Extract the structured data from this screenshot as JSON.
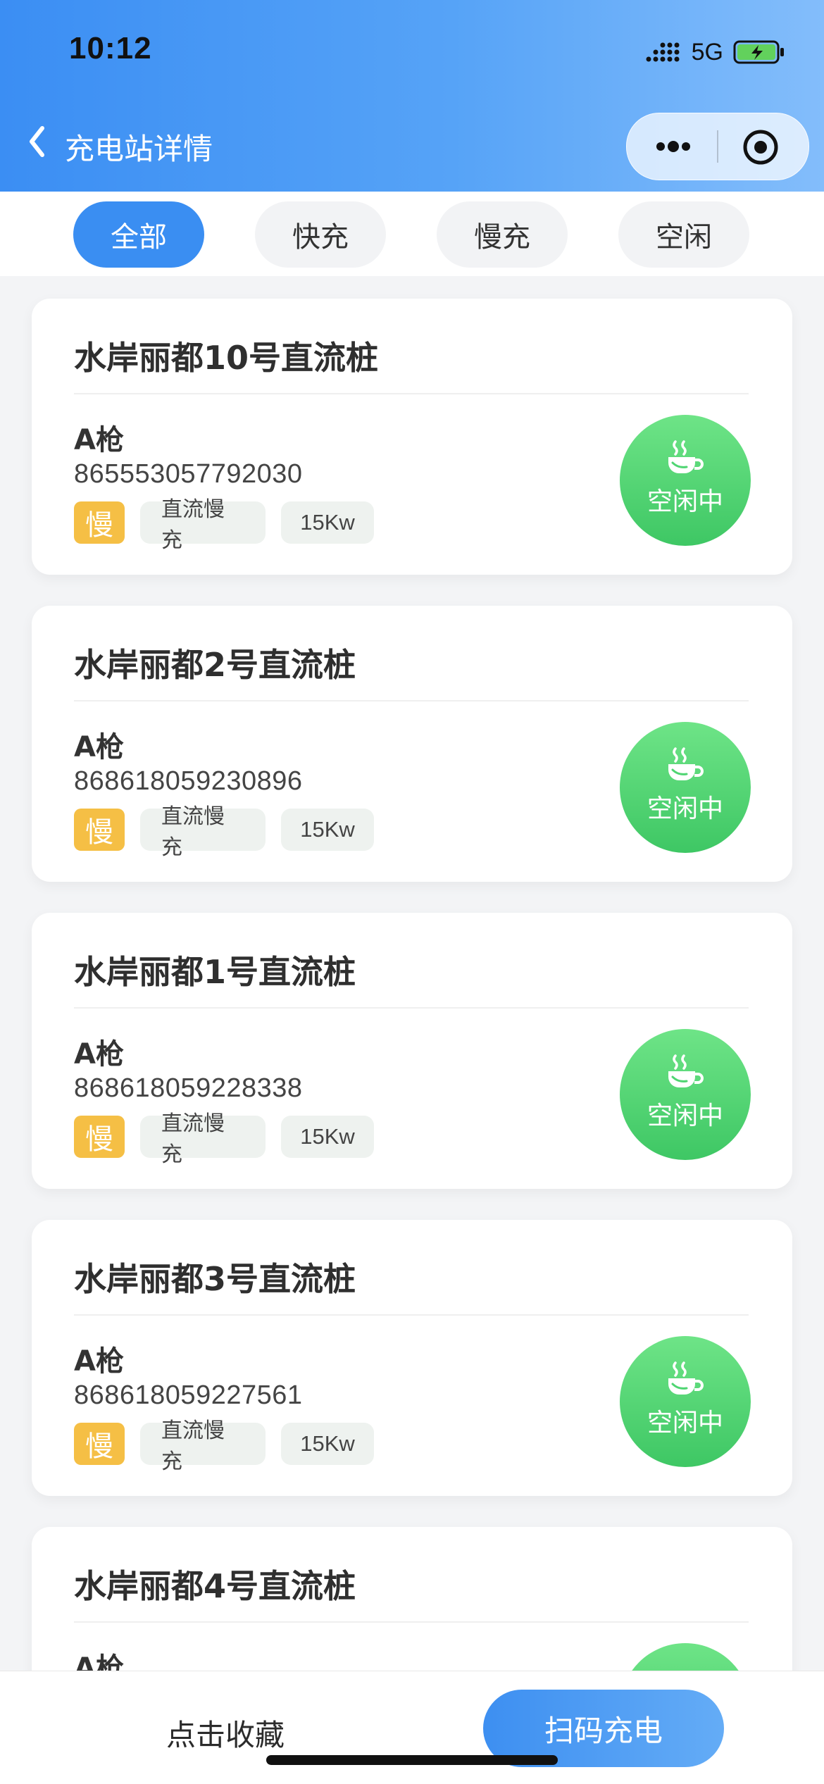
{
  "status_bar": {
    "time": "10:12",
    "network": "5G",
    "icons": [
      "signal-icon",
      "battery-charging-icon"
    ]
  },
  "nav": {
    "title": "充电站详情",
    "back_icon": "chevron-left-icon",
    "more_icon": "more-dots-icon",
    "close_icon": "target-close-icon"
  },
  "filters": [
    {
      "label": "全部",
      "active": true
    },
    {
      "label": "快充",
      "active": false
    },
    {
      "label": "慢充",
      "active": false
    },
    {
      "label": "空闲",
      "active": false
    }
  ],
  "piles": [
    {
      "title": "水岸丽都10号直流桩",
      "gun": "A枪",
      "serial": "865553057792030",
      "badge": "慢",
      "type": "直流慢充",
      "power": "15Kw",
      "status": "空闲中"
    },
    {
      "title": "水岸丽都2号直流桩",
      "gun": "A枪",
      "serial": "868618059230896",
      "badge": "慢",
      "type": "直流慢充",
      "power": "15Kw",
      "status": "空闲中"
    },
    {
      "title": "水岸丽都1号直流桩",
      "gun": "A枪",
      "serial": "868618059228338",
      "badge": "慢",
      "type": "直流慢充",
      "power": "15Kw",
      "status": "空闲中"
    },
    {
      "title": "水岸丽都3号直流桩",
      "gun": "A枪",
      "serial": "868618059227561",
      "badge": "慢",
      "type": "直流慢充",
      "power": "15Kw",
      "status": "空闲中"
    },
    {
      "title": "水岸丽都4号直流桩",
      "gun": "A枪"
    }
  ],
  "bottom": {
    "favorite": "点击收藏",
    "scan": "扫码充电"
  },
  "colors": {
    "primary": "#3a8ef2",
    "status_green": "#4fd572",
    "slow_badge": "#f5bf45"
  }
}
